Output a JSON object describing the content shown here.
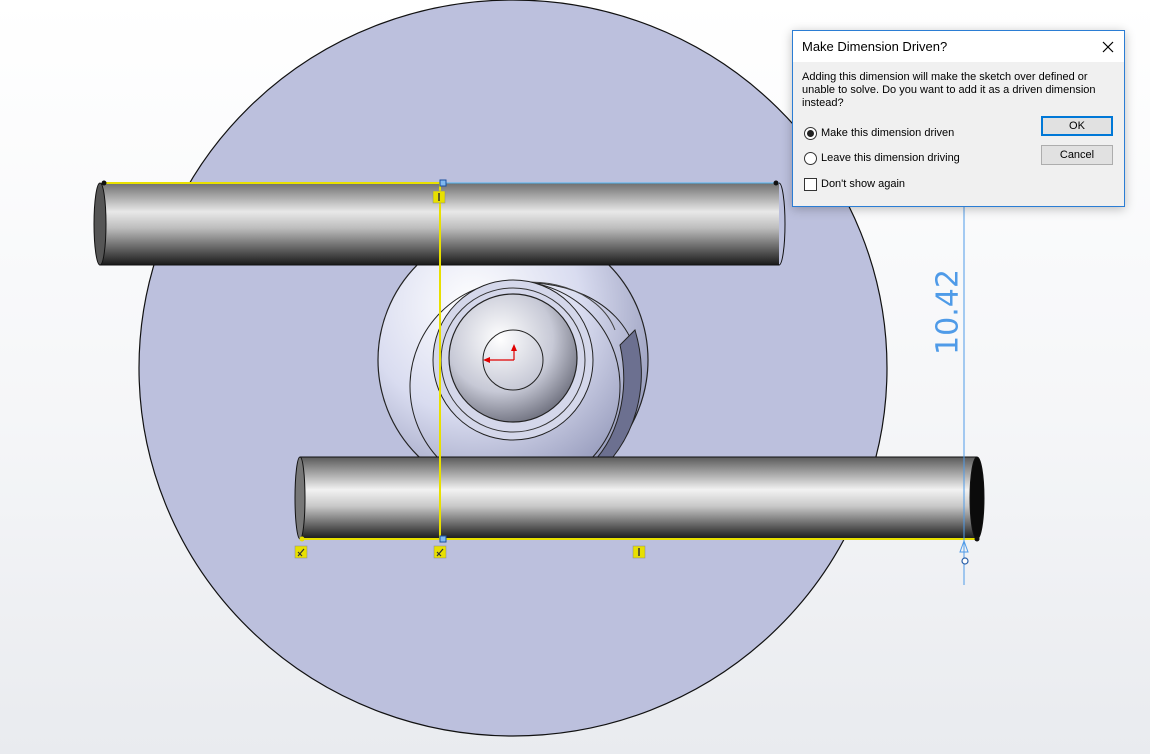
{
  "dialog": {
    "title": "Make Dimension Driven?",
    "message": "Adding this dimension will make the sketch over defined or unable to solve.  Do you want to add it as a driven dimension instead?",
    "options": [
      {
        "label": "Make this dimension driven",
        "selected": true
      },
      {
        "label": "Leave this dimension driving",
        "selected": false
      }
    ],
    "dont_show_label": "Don't show again",
    "dont_show_checked": false,
    "ok_label": "OK",
    "cancel_label": "Cancel"
  },
  "dimension": {
    "value": "10.42",
    "color": "#4f9be8"
  },
  "colors": {
    "disk": "#bcc0dd",
    "sketch_line": "#e8e000",
    "dimension": "#4f9be8",
    "origin": "#e00000"
  },
  "icons": [
    "close-icon",
    "origin-icon",
    "coincident-relation-icon",
    "vertical-relation-icon",
    "horizontal-relation-icon"
  ]
}
